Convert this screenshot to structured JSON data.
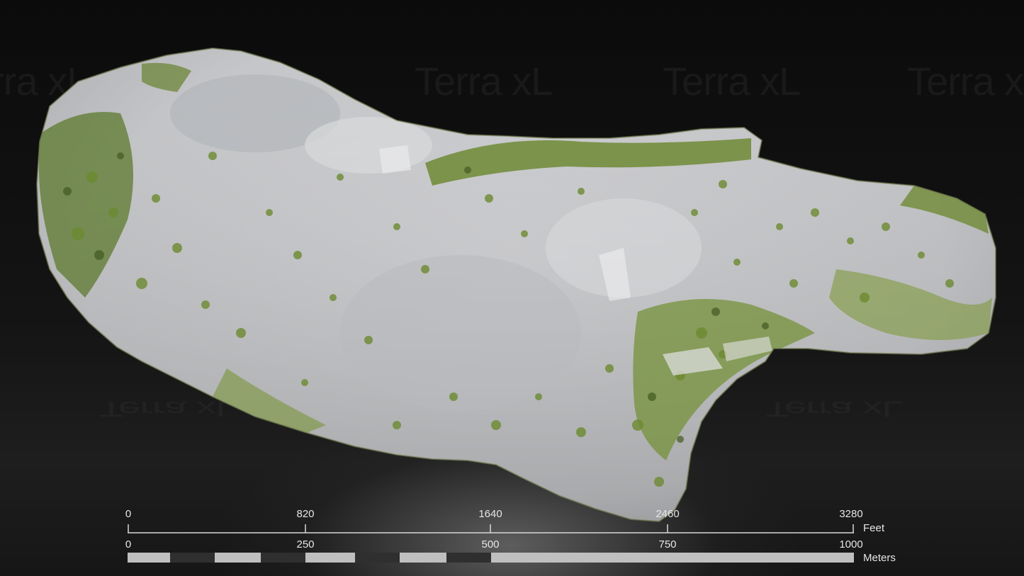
{
  "watermark": {
    "text": "Terra xL"
  },
  "map": {
    "subject": "terrain-model",
    "colors": {
      "rock": "#c9c9cc",
      "rock_shadow": "#9a9ca0",
      "vegetation": "#7f9a3a",
      "vegetation_dark": "#4f6a2a",
      "background": "#0c0c0c"
    }
  },
  "scale_bar": {
    "feet": {
      "unit": "Feet",
      "ticks": [
        "0",
        "820",
        "1640",
        "2460",
        "3280"
      ]
    },
    "meters": {
      "unit": "Meters",
      "ticks": [
        "0",
        "250",
        "500",
        "750",
        "1000"
      ]
    }
  }
}
